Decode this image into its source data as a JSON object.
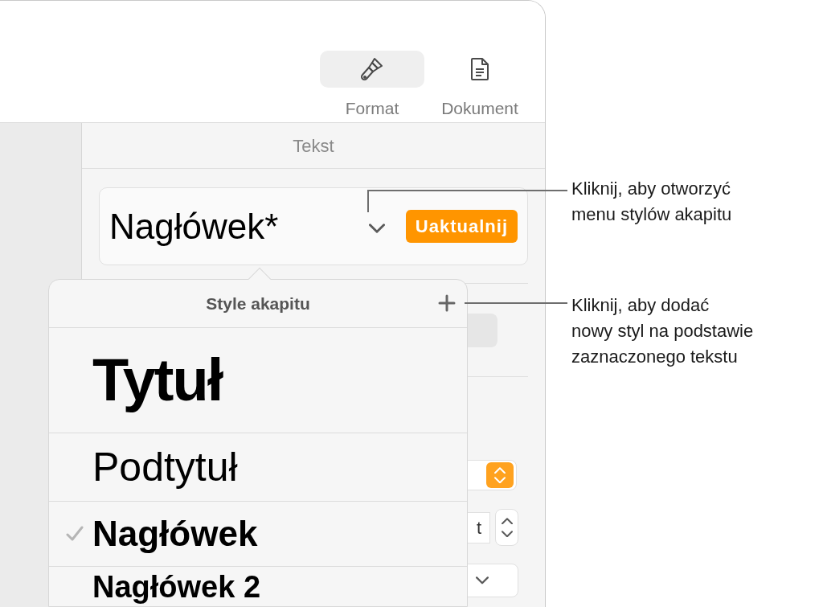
{
  "toolbar": {
    "buttons": [
      {
        "label": "Format",
        "kind": "brush",
        "selected": true
      },
      {
        "label": "Dokument",
        "kind": "document",
        "selected": false
      }
    ]
  },
  "sidebar": {
    "section_title": "Tekst",
    "style_field": {
      "value": "Nagłówek*",
      "update_button": "Uaktualnij"
    },
    "size_field": {
      "value": "t"
    }
  },
  "popover": {
    "title": "Style akapitu",
    "styles": [
      {
        "label": "Tytuł",
        "kind": "title",
        "checked": false
      },
      {
        "label": "Podtytuł",
        "kind": "subtitle",
        "checked": false
      },
      {
        "label": "Nagłówek",
        "kind": "heading",
        "checked": true
      },
      {
        "label": "Nagłówek 2",
        "kind": "heading2",
        "checked": false
      }
    ]
  },
  "callouts": [
    {
      "lines": [
        "Kliknij, aby otworzyć",
        "menu stylów akapitu"
      ]
    },
    {
      "lines": [
        "Kliknij, aby dodać",
        "nowy styl na podstawie",
        "zaznaczonego tekstu"
      ]
    }
  ]
}
